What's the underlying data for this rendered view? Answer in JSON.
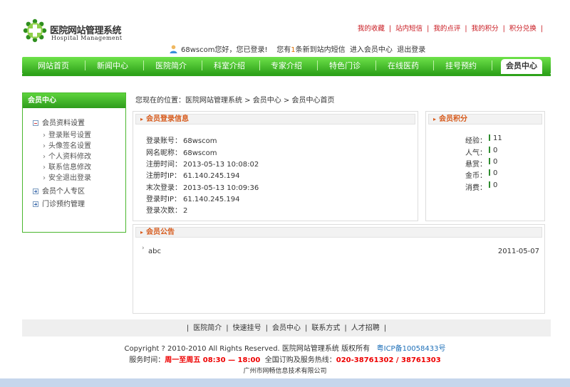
{
  "logo": {
    "title": "医院网站管理系统",
    "subtitle": "Hospital Management",
    "icon": "green-cross-logo-icon"
  },
  "top_links": [
    "我的收藏",
    "站内短信",
    "我的点评",
    "我的积分",
    "积分兑换"
  ],
  "welcome": {
    "icon": "person-icon",
    "greeting": "68wscom您好，您已登录!",
    "msg_prefix": "您有",
    "msg_count": "1",
    "msg_suffix": "条新到站内短信",
    "member_center_link": "进入会员中心",
    "logout_link": "退出登录"
  },
  "nav": {
    "items": [
      "网站首页",
      "新闻中心",
      "医院简介",
      "科室介绍",
      "专家介绍",
      "特色门诊",
      "在线医药",
      "挂号预约",
      "会员中心"
    ],
    "active_index": 8,
    "color_top": "#6ee24a",
    "color_bottom": "#2ea21a"
  },
  "sidebar": {
    "title": "会员中心",
    "groups": [
      {
        "label": "会员资料设置",
        "expanded": true,
        "items": [
          "登录账号设置",
          "头像签名设置",
          "个人资料修改",
          "联系信息修改",
          "安全退出登录"
        ]
      },
      {
        "label": "会员个人专区",
        "expanded": false
      },
      {
        "label": "门诊预约管理",
        "expanded": false
      }
    ]
  },
  "breadcrumb": "您现在的位置：医院网站管理系统 > 会员中心 > 会员中心首页",
  "login_info": {
    "title": "会员登录信息",
    "rows": [
      {
        "label": "登录账号：",
        "value": "68wscom"
      },
      {
        "label": "网名昵称：",
        "value": "68wscom"
      },
      {
        "label": "注册时间：",
        "value": "2013-05-13 10:08:02"
      },
      {
        "label": "注册时IP：",
        "value": "61.140.245.194"
      },
      {
        "label": "末次登录：",
        "value": "2013-05-13 10:09:36"
      },
      {
        "label": "登录时IP：",
        "value": "61.140.245.194"
      },
      {
        "label": "登录次数：",
        "value": "2"
      }
    ]
  },
  "score": {
    "title": "会员积分",
    "rows": [
      {
        "label": "经验：",
        "value": "11"
      },
      {
        "label": "人气：",
        "value": "0"
      },
      {
        "label": "悬赏：",
        "value": "0"
      },
      {
        "label": "金币：",
        "value": "0"
      },
      {
        "label": "消费：",
        "value": "0"
      }
    ]
  },
  "notice": {
    "title": "会员公告",
    "items": [
      {
        "title": "abc",
        "date": "2011-05-07"
      }
    ]
  },
  "footer": {
    "links": [
      "医院简介",
      "快速挂号",
      "会员中心",
      "联系方式",
      "人才招聘"
    ],
    "copyright": "Copyright ? 2010-2010 All Rights Reserved. 医院网站管理系统 版权所有",
    "icp": "粤ICP备10058433号",
    "service_prefix": "服务时间：",
    "service_time": "周一至周五 08:30 — 18:00",
    "hotline_prefix": "全国订购及服务热线：",
    "hotline": "020-38761302 / 38761303",
    "company": "广州市网畅信息技术有限公司"
  }
}
